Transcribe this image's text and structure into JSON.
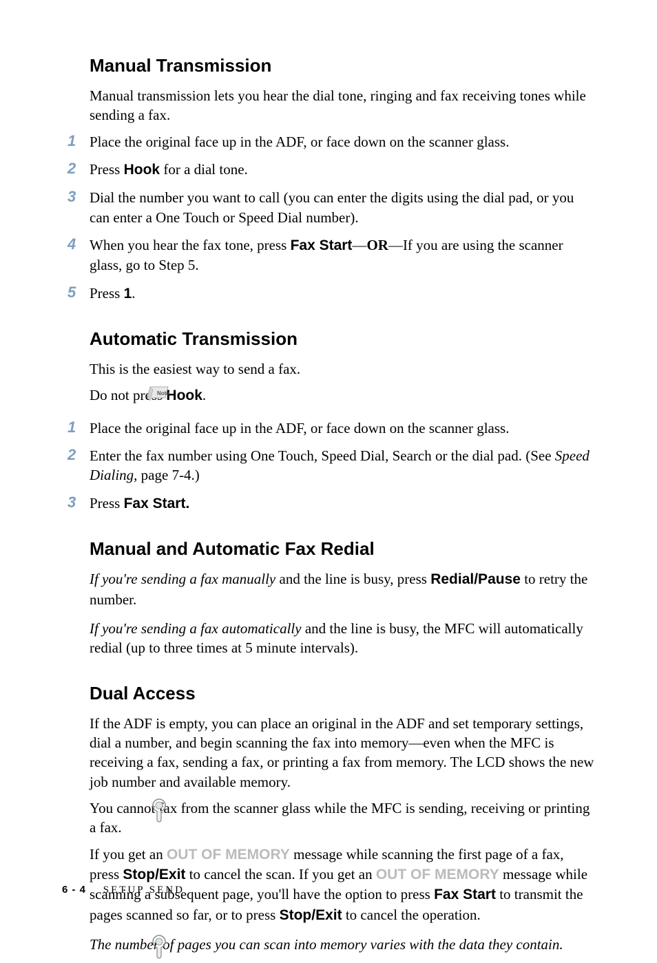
{
  "sections": {
    "s1": {
      "heading": "Manual Transmission",
      "intro": "Manual transmission lets you hear the dial tone, ringing and fax receiving tones while sending a fax.",
      "steps": {
        "n1": "1",
        "t1": "Place the original face up in the ADF, or face down on the scanner glass.",
        "n2": "2",
        "t2a": "Press ",
        "t2b": "Hook",
        "t2c": " for a dial tone.",
        "n3": "3",
        "t3": "Dial the number you want to call (you can enter the digits using the dial pad, or you can enter a One Touch or Speed Dial number).",
        "n4": "4",
        "t4a": "When you hear the fax tone, press ",
        "t4b": "Fax Start",
        "t4c": "—",
        "t4d": "OR",
        "t4e": "—If you are using the scanner glass, go to Step 5.",
        "n5": "5",
        "t5a": "Press ",
        "t5b": "1",
        "t5c": "."
      }
    },
    "s2": {
      "heading": "Automatic Transmission",
      "intro": "This is the easiest way to send a fax.",
      "note_a": "Do not press ",
      "note_b": "Hook",
      "note_c": ".",
      "steps": {
        "n1": "1",
        "t1": "Place the original face up in the ADF, or face down on the scanner glass.",
        "n2": "2",
        "t2a": "Enter the fax number using One Touch, Speed Dial, Search or the dial pad. (See ",
        "t2b": "Speed Dialing",
        "t2c": ", page 7-4.)",
        "n3": "3",
        "t3a": "Press ",
        "t3b": "Fax Start."
      }
    },
    "s3": {
      "heading": "Manual and Automatic Fax Redial",
      "p1a": "If you're sending a fax manually",
      "p1b": " and the line is busy, press ",
      "p1c": "Redial/Pause",
      "p1d": " to retry the number.",
      "p2a": "If you're sending a fax automatically",
      "p2b": " and the line is busy, the MFC will automatically redial (up to three times at 5 minute intervals)."
    },
    "s4": {
      "heading": "Dual Access",
      "p1": "If the ADF is empty, you can place an original in the ADF and set temporary settings, dial a number, and begin scanning the fax into memory—even when the MFC is receiving a fax, sending a fax, or printing a fax from memory. The LCD shows the new job number and available memory.",
      "note1": "You cannot fax from the scanner glass while the MFC is sending, receiving or printing a fax.",
      "p2a": "If you get an ",
      "p2b": "OUT OF MEMORY",
      "p2c": " message while scanning the first page of a fax, press ",
      "p2d": "Stop/Exit",
      "p2e": " to cancel the scan. If you get an ",
      "p2f": "OUT OF MEMORY",
      "p2g": " message while scanning a subsequent page, you'll have the option to press ",
      "p2h": "Fax Start",
      "p2i": " to transmit the pages scanned so far, or to press ",
      "p2j": "Stop/Exit",
      "p2k": " to cancel the operation.",
      "note2": "The number of pages you can scan into memory varies with the data they contain."
    }
  },
  "footer": {
    "page": "6 - 4",
    "title": "SETUP SEND"
  }
}
